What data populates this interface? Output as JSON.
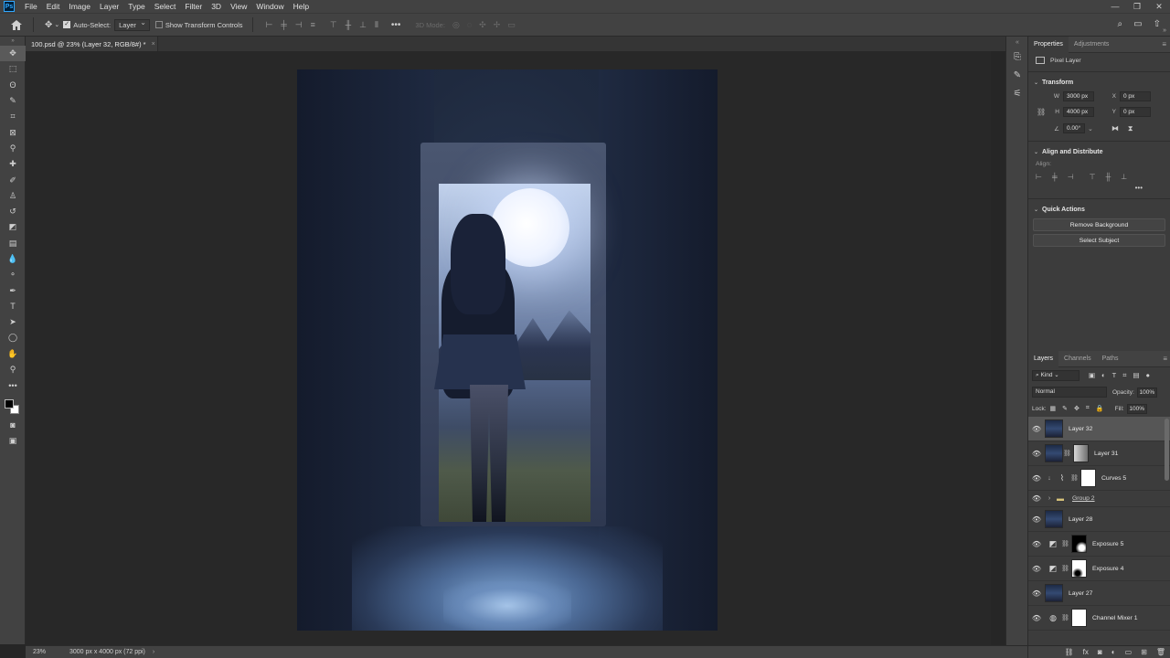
{
  "menubar": {
    "logo": "Ps",
    "items": [
      "File",
      "Edit",
      "Image",
      "Layer",
      "Type",
      "Select",
      "Filter",
      "3D",
      "View",
      "Window",
      "Help"
    ],
    "window_controls": [
      "—",
      "❐",
      "✕"
    ]
  },
  "options": {
    "auto_select_label": "Auto-Select:",
    "auto_select_checked": true,
    "auto_select_target": "Layer",
    "show_transform_label": "Show Transform Controls",
    "show_transform_checked": false,
    "more_label": "•••",
    "mode_3d_label": "3D Mode:"
  },
  "document": {
    "tab_title": "100.psd @ 23% (Layer 32, RGB/8#) *",
    "close": "×"
  },
  "status": {
    "zoom": "23%",
    "doc_info": "3000 px x 4000 px (72 ppi)",
    "arrow": "›"
  },
  "properties": {
    "tabs": [
      "Properties",
      "Adjustments"
    ],
    "active_tab": "Properties",
    "layer_type": "Pixel Layer",
    "transform": {
      "title": "Transform",
      "w_label": "W",
      "w_value": "3000 px",
      "h_label": "H",
      "h_value": "4000 px",
      "x_label": "X",
      "x_value": "0 px",
      "y_label": "Y",
      "y_value": "0 px",
      "angle_value": "0.00°"
    },
    "align": {
      "title": "Align and Distribute",
      "label": "Align:",
      "more": "•••"
    },
    "quick_actions": {
      "title": "Quick Actions",
      "remove_bg": "Remove Background",
      "select_subject": "Select Subject"
    }
  },
  "layers_panel": {
    "tabs": [
      "Layers",
      "Channels",
      "Paths"
    ],
    "active_tab": "Layers",
    "kind_label": "Kind",
    "blend_mode": "Normal",
    "opacity_label": "Opacity:",
    "opacity_value": "100%",
    "lock_label": "Lock:",
    "fill_label": "Fill:",
    "fill_value": "100%",
    "layers": [
      {
        "name": "Layer 32",
        "type": "pixel",
        "selected": true
      },
      {
        "name": "Layer 31",
        "type": "pixel-mask",
        "mask": "grad",
        "selected": false
      },
      {
        "name": "Curves 5",
        "type": "adjustment",
        "icon": "curves",
        "mask": "white",
        "clip": true,
        "selected": false
      },
      {
        "name": "Group 2",
        "type": "group",
        "selected": false
      },
      {
        "name": "Layer 28",
        "type": "pixel",
        "selected": false
      },
      {
        "name": "Exposure 5",
        "type": "adjustment",
        "icon": "exposure",
        "mask": "black-spot",
        "selected": false
      },
      {
        "name": "Exposure 4",
        "type": "adjustment",
        "icon": "exposure",
        "mask": "white-spot",
        "selected": false
      },
      {
        "name": "Layer 27",
        "type": "pixel",
        "selected": false
      },
      {
        "name": "Channel Mixer 1",
        "type": "adjustment",
        "icon": "mixer",
        "mask": "white",
        "selected": false
      }
    ]
  },
  "colors": {
    "ui_dark": "#262626",
    "panel": "#3c3c3c",
    "bar": "#424242",
    "selected_row": "#565656",
    "ps_blue": "#31a8ff"
  }
}
